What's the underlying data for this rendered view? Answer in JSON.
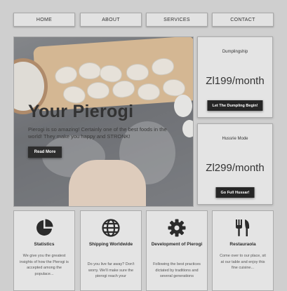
{
  "nav": {
    "items": [
      {
        "label": "HOME"
      },
      {
        "label": "ABOUT"
      },
      {
        "label": "SERVICES"
      },
      {
        "label": "CONTACT"
      }
    ]
  },
  "hero": {
    "title": "Your Pierogi",
    "text": "Pierogi is so amazing! Certainly one of the best foods in the world! They make you happy and STRONK!",
    "button_label": "Read More"
  },
  "pricing": [
    {
      "name": "Dumplingship",
      "price": "Zl199/month",
      "button_label": "Let The Dumpling Begin!"
    },
    {
      "name": "Hussrie Mode",
      "price": "Zl299/month",
      "button_label": "Go Full Hussar!"
    }
  ],
  "features": [
    {
      "icon": "pie-chart-icon",
      "title": "Statistics",
      "text": "We give you the greatest insights of how the Pierogi is accepted among the populace..."
    },
    {
      "icon": "globe-icon",
      "title": "Shipping Worldwide",
      "text": "Do you live far away? Don't worry. We'll make sure the pierogi reach your"
    },
    {
      "icon": "gear-icon",
      "title": "Development of Pierogi",
      "text": "Following the best practices dictated by traditions and several generations"
    },
    {
      "icon": "utensils-icon",
      "title": "Restauraola",
      "text": "Come over to our place, sit at our table and enjoy this fine cuisine..."
    }
  ]
}
